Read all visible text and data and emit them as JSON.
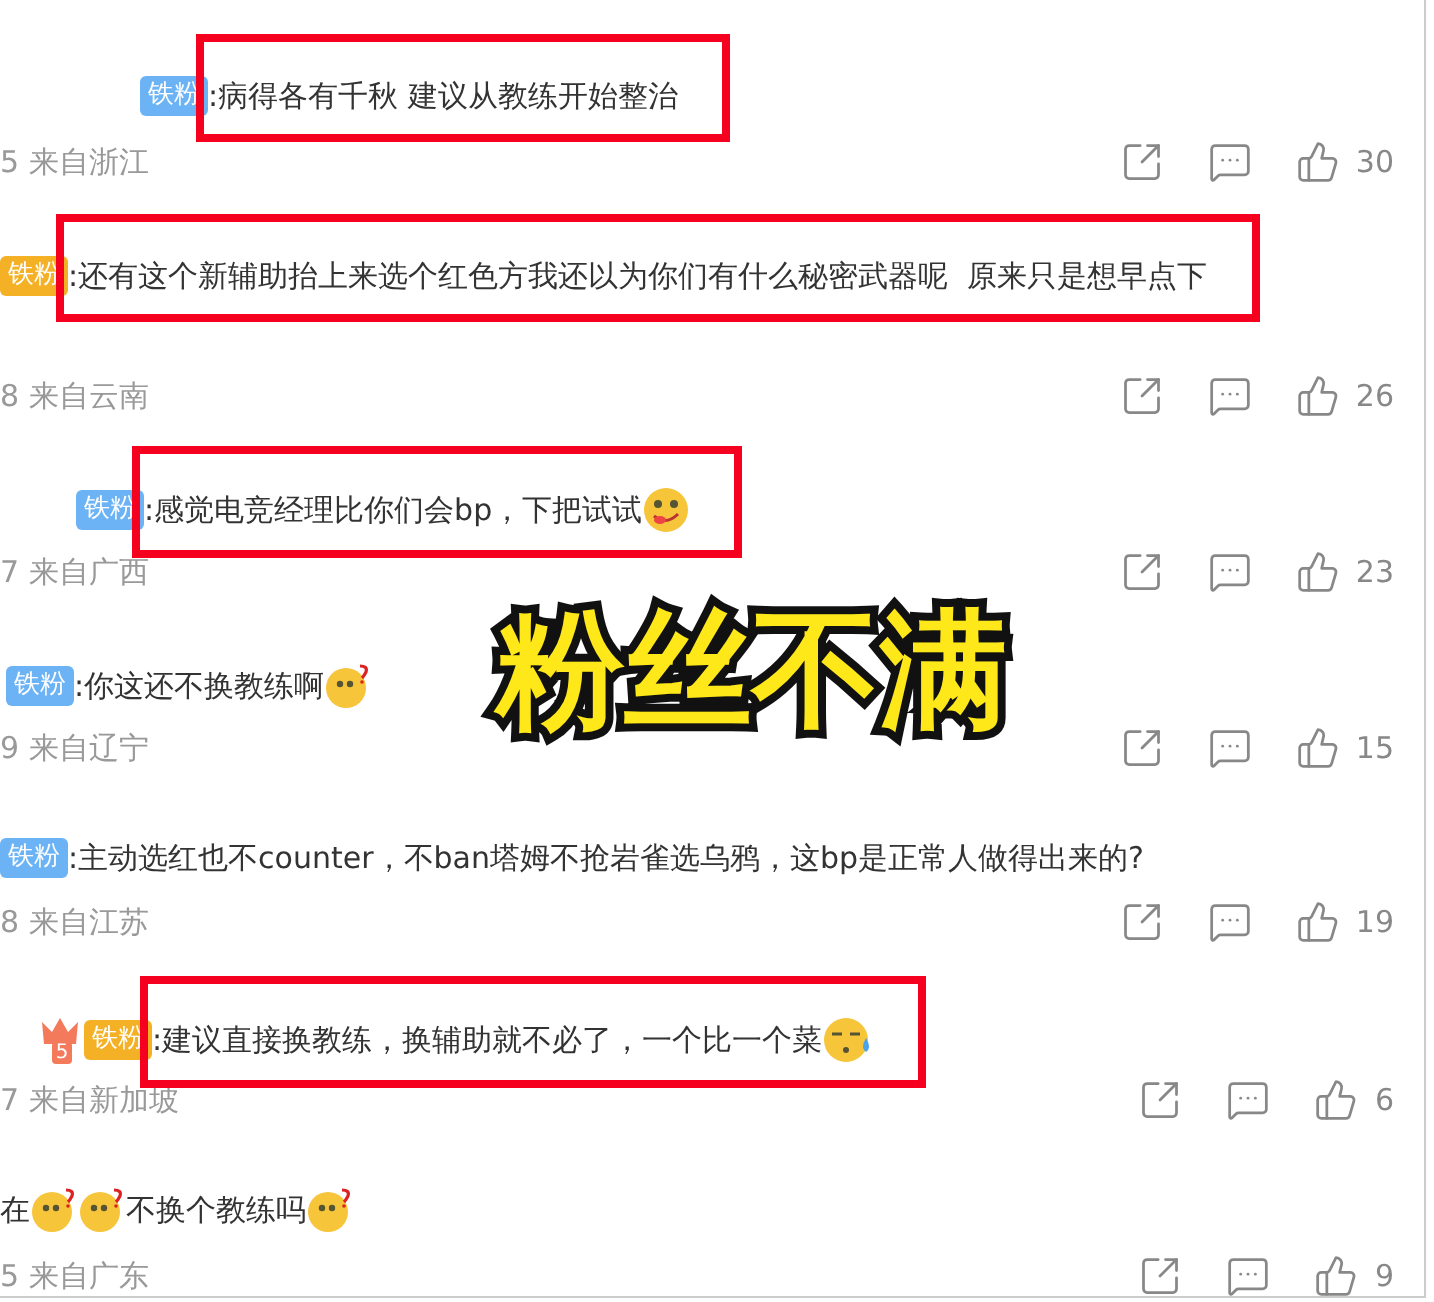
{
  "overlay_caption": "粉丝不满",
  "comments": [
    {
      "badge": {
        "text": "铁粉",
        "color": "#6cb3f5"
      },
      "highlighted": true,
      "segments": [
        {
          "kind": "text",
          "text": ":病得各有千秋 建议从教练开始整治"
        }
      ],
      "meta": "5 来自浙江",
      "likes": "30"
    },
    {
      "badge": {
        "text": "铁粉",
        "color": "#f5b125"
      },
      "highlighted": true,
      "segments": [
        {
          "kind": "text",
          "text": ":还有这个新辅助抬上来选个红色方我还以为你们有什么秘密武器呢  原来只是想早点下"
        }
      ],
      "meta": "8 来自云南",
      "likes": "26"
    },
    {
      "badge": {
        "text": "铁粉",
        "color": "#6cb3f5"
      },
      "highlighted": true,
      "segments": [
        {
          "kind": "text",
          "text": ":感觉电竞经理比你们会bp，下把试试"
        },
        {
          "kind": "tongue"
        }
      ],
      "meta": "7 来自广西",
      "likes": "23"
    },
    {
      "badge": {
        "text": "铁粉",
        "color": "#6cb3f5"
      },
      "highlighted": false,
      "segments": [
        {
          "kind": "text",
          "text": ":你这还不换教练啊"
        },
        {
          "kind": "puzzled"
        }
      ],
      "meta": "9 来自辽宁",
      "likes": "15"
    },
    {
      "badge": {
        "text": "铁粉",
        "color": "#6cb3f5"
      },
      "highlighted": false,
      "segments": [
        {
          "kind": "text",
          "text": ":主动选红也不counter，不ban塔姆不抢岩雀选乌鸦，这bp是正常人做得出来的?"
        }
      ],
      "meta": "8 来自江苏",
      "likes": "19"
    },
    {
      "badge": {
        "text": "铁粉",
        "color": "#f5b125",
        "crown_level": "5"
      },
      "highlighted": true,
      "segments": [
        {
          "kind": "text",
          "text": ":建议直接换教练，换辅助就不必了，一个比一个菜"
        },
        {
          "kind": "sweat"
        }
      ],
      "meta": "7 来自新加坡",
      "likes": "6"
    },
    {
      "highlighted": false,
      "segments": [
        {
          "kind": "text",
          "text": "在"
        },
        {
          "kind": "puzzled"
        },
        {
          "kind": "puzzled"
        },
        {
          "kind": "text",
          "text": "不换个教练吗"
        },
        {
          "kind": "puzzled"
        }
      ],
      "meta": "5 来自广东",
      "likes": "9"
    }
  ]
}
